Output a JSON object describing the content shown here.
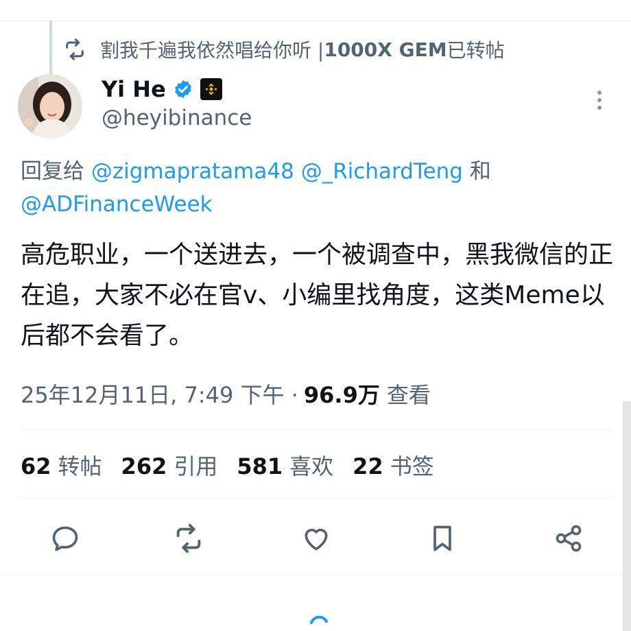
{
  "repost": {
    "icon": "repost-icon",
    "name": "割我千遍我依然唱给你听 | ",
    "name_strong": "1000X GEM",
    "suffix": " 已转帖"
  },
  "author": {
    "name": "Yi He",
    "handle": "@heyibinance",
    "verified_icon": "verified-badge-icon",
    "affiliation_icon": "binance-logo-icon",
    "more_icon": "more-vertical-icon"
  },
  "reply": {
    "prefix": "回复给 ",
    "mention1": "@zigmapratama48",
    "mention2": "@_RichardTeng",
    "conj": " 和",
    "mention3": "@ADFinanceWeek"
  },
  "tweet": {
    "text": "高危职业，一个送进去，一个被调查中，黑我微信的正在追，大家不必在官v、小编里找角度，这类Meme以后都不会看了。"
  },
  "meta": {
    "timestamp": "25年12月11日, 7:49 下午 ·",
    "views": "96.9万",
    "views_label": "查看"
  },
  "stats": [
    {
      "num": "62",
      "label": "转帖"
    },
    {
      "num": "262",
      "label": "引用"
    },
    {
      "num": "581",
      "label": "喜欢"
    },
    {
      "num": "22",
      "label": "书签"
    }
  ],
  "actions": {
    "reply": "reply-icon",
    "repost": "repost-icon",
    "like": "like-icon",
    "bookmark": "bookmark-icon",
    "share": "share-icon"
  },
  "colors": {
    "link": "#1d9bf0",
    "secondary": "#536471",
    "primary": "#0f1419",
    "binance": "#f0b90b"
  }
}
